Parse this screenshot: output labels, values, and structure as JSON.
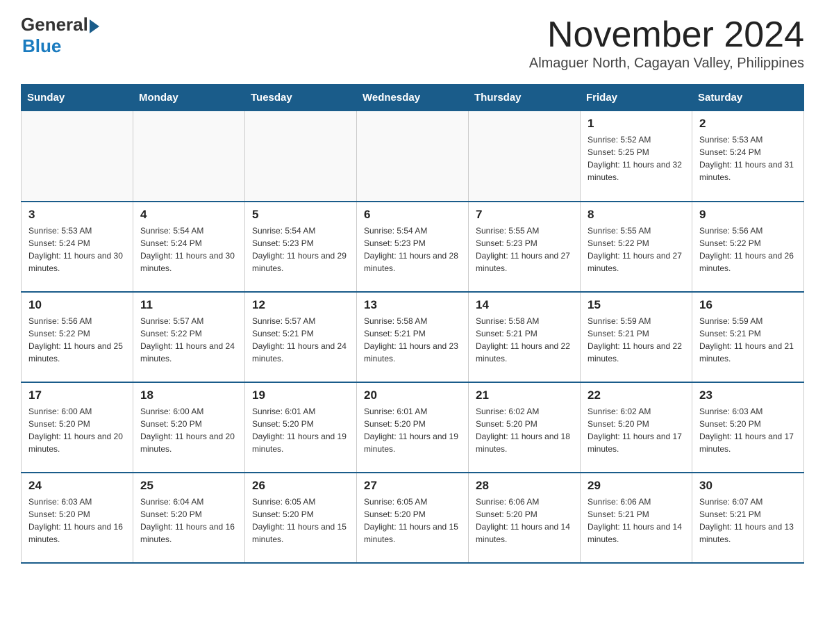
{
  "header": {
    "logo_general": "General",
    "logo_blue": "Blue",
    "month_title": "November 2024",
    "subtitle": "Almaguer North, Cagayan Valley, Philippines"
  },
  "days_of_week": [
    "Sunday",
    "Monday",
    "Tuesday",
    "Wednesday",
    "Thursday",
    "Friday",
    "Saturday"
  ],
  "weeks": [
    [
      {
        "day": "",
        "sunrise": "",
        "sunset": "",
        "daylight": ""
      },
      {
        "day": "",
        "sunrise": "",
        "sunset": "",
        "daylight": ""
      },
      {
        "day": "",
        "sunrise": "",
        "sunset": "",
        "daylight": ""
      },
      {
        "day": "",
        "sunrise": "",
        "sunset": "",
        "daylight": ""
      },
      {
        "day": "",
        "sunrise": "",
        "sunset": "",
        "daylight": ""
      },
      {
        "day": "1",
        "sunrise": "Sunrise: 5:52 AM",
        "sunset": "Sunset: 5:25 PM",
        "daylight": "Daylight: 11 hours and 32 minutes."
      },
      {
        "day": "2",
        "sunrise": "Sunrise: 5:53 AM",
        "sunset": "Sunset: 5:24 PM",
        "daylight": "Daylight: 11 hours and 31 minutes."
      }
    ],
    [
      {
        "day": "3",
        "sunrise": "Sunrise: 5:53 AM",
        "sunset": "Sunset: 5:24 PM",
        "daylight": "Daylight: 11 hours and 30 minutes."
      },
      {
        "day": "4",
        "sunrise": "Sunrise: 5:54 AM",
        "sunset": "Sunset: 5:24 PM",
        "daylight": "Daylight: 11 hours and 30 minutes."
      },
      {
        "day": "5",
        "sunrise": "Sunrise: 5:54 AM",
        "sunset": "Sunset: 5:23 PM",
        "daylight": "Daylight: 11 hours and 29 minutes."
      },
      {
        "day": "6",
        "sunrise": "Sunrise: 5:54 AM",
        "sunset": "Sunset: 5:23 PM",
        "daylight": "Daylight: 11 hours and 28 minutes."
      },
      {
        "day": "7",
        "sunrise": "Sunrise: 5:55 AM",
        "sunset": "Sunset: 5:23 PM",
        "daylight": "Daylight: 11 hours and 27 minutes."
      },
      {
        "day": "8",
        "sunrise": "Sunrise: 5:55 AM",
        "sunset": "Sunset: 5:22 PM",
        "daylight": "Daylight: 11 hours and 27 minutes."
      },
      {
        "day": "9",
        "sunrise": "Sunrise: 5:56 AM",
        "sunset": "Sunset: 5:22 PM",
        "daylight": "Daylight: 11 hours and 26 minutes."
      }
    ],
    [
      {
        "day": "10",
        "sunrise": "Sunrise: 5:56 AM",
        "sunset": "Sunset: 5:22 PM",
        "daylight": "Daylight: 11 hours and 25 minutes."
      },
      {
        "day": "11",
        "sunrise": "Sunrise: 5:57 AM",
        "sunset": "Sunset: 5:22 PM",
        "daylight": "Daylight: 11 hours and 24 minutes."
      },
      {
        "day": "12",
        "sunrise": "Sunrise: 5:57 AM",
        "sunset": "Sunset: 5:21 PM",
        "daylight": "Daylight: 11 hours and 24 minutes."
      },
      {
        "day": "13",
        "sunrise": "Sunrise: 5:58 AM",
        "sunset": "Sunset: 5:21 PM",
        "daylight": "Daylight: 11 hours and 23 minutes."
      },
      {
        "day": "14",
        "sunrise": "Sunrise: 5:58 AM",
        "sunset": "Sunset: 5:21 PM",
        "daylight": "Daylight: 11 hours and 22 minutes."
      },
      {
        "day": "15",
        "sunrise": "Sunrise: 5:59 AM",
        "sunset": "Sunset: 5:21 PM",
        "daylight": "Daylight: 11 hours and 22 minutes."
      },
      {
        "day": "16",
        "sunrise": "Sunrise: 5:59 AM",
        "sunset": "Sunset: 5:21 PM",
        "daylight": "Daylight: 11 hours and 21 minutes."
      }
    ],
    [
      {
        "day": "17",
        "sunrise": "Sunrise: 6:00 AM",
        "sunset": "Sunset: 5:20 PM",
        "daylight": "Daylight: 11 hours and 20 minutes."
      },
      {
        "day": "18",
        "sunrise": "Sunrise: 6:00 AM",
        "sunset": "Sunset: 5:20 PM",
        "daylight": "Daylight: 11 hours and 20 minutes."
      },
      {
        "day": "19",
        "sunrise": "Sunrise: 6:01 AM",
        "sunset": "Sunset: 5:20 PM",
        "daylight": "Daylight: 11 hours and 19 minutes."
      },
      {
        "day": "20",
        "sunrise": "Sunrise: 6:01 AM",
        "sunset": "Sunset: 5:20 PM",
        "daylight": "Daylight: 11 hours and 19 minutes."
      },
      {
        "day": "21",
        "sunrise": "Sunrise: 6:02 AM",
        "sunset": "Sunset: 5:20 PM",
        "daylight": "Daylight: 11 hours and 18 minutes."
      },
      {
        "day": "22",
        "sunrise": "Sunrise: 6:02 AM",
        "sunset": "Sunset: 5:20 PM",
        "daylight": "Daylight: 11 hours and 17 minutes."
      },
      {
        "day": "23",
        "sunrise": "Sunrise: 6:03 AM",
        "sunset": "Sunset: 5:20 PM",
        "daylight": "Daylight: 11 hours and 17 minutes."
      }
    ],
    [
      {
        "day": "24",
        "sunrise": "Sunrise: 6:03 AM",
        "sunset": "Sunset: 5:20 PM",
        "daylight": "Daylight: 11 hours and 16 minutes."
      },
      {
        "day": "25",
        "sunrise": "Sunrise: 6:04 AM",
        "sunset": "Sunset: 5:20 PM",
        "daylight": "Daylight: 11 hours and 16 minutes."
      },
      {
        "day": "26",
        "sunrise": "Sunrise: 6:05 AM",
        "sunset": "Sunset: 5:20 PM",
        "daylight": "Daylight: 11 hours and 15 minutes."
      },
      {
        "day": "27",
        "sunrise": "Sunrise: 6:05 AM",
        "sunset": "Sunset: 5:20 PM",
        "daylight": "Daylight: 11 hours and 15 minutes."
      },
      {
        "day": "28",
        "sunrise": "Sunrise: 6:06 AM",
        "sunset": "Sunset: 5:20 PM",
        "daylight": "Daylight: 11 hours and 14 minutes."
      },
      {
        "day": "29",
        "sunrise": "Sunrise: 6:06 AM",
        "sunset": "Sunset: 5:21 PM",
        "daylight": "Daylight: 11 hours and 14 minutes."
      },
      {
        "day": "30",
        "sunrise": "Sunrise: 6:07 AM",
        "sunset": "Sunset: 5:21 PM",
        "daylight": "Daylight: 11 hours and 13 minutes."
      }
    ]
  ]
}
